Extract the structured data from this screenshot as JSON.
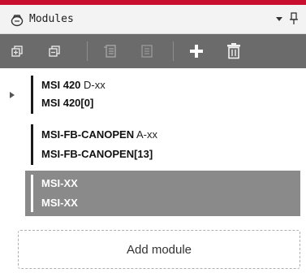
{
  "panel": {
    "title": "Modules"
  },
  "toolbar": {
    "buttons": [
      {
        "icon": "expand-all-icon",
        "enabled": true
      },
      {
        "icon": "collapse-all-icon",
        "enabled": true
      },
      {
        "icon": "properties-icon",
        "enabled": false
      },
      {
        "icon": "configure-icon",
        "enabled": false
      },
      {
        "icon": "add-icon",
        "enabled": true
      },
      {
        "icon": "delete-icon",
        "enabled": true
      }
    ]
  },
  "modules": [
    {
      "name": "MSI 420",
      "suffix": "D-xx",
      "instance": "MSI 420[0]",
      "expandable": true,
      "selected": false
    },
    {
      "name": "MSI-FB-CANOPEN",
      "suffix": "A-xx",
      "instance": "MSI-FB-CANOPEN[13]",
      "expandable": false,
      "selected": false
    },
    {
      "name": "MSI-XX",
      "suffix": "",
      "instance": "MSI-XX",
      "expandable": false,
      "selected": true
    }
  ],
  "add_module": {
    "label": "Add module"
  },
  "colors": {
    "accent": "#c8102e",
    "toolbar_bg": "#6b6b6b",
    "selected_row_bg": "#8a8a8a"
  }
}
